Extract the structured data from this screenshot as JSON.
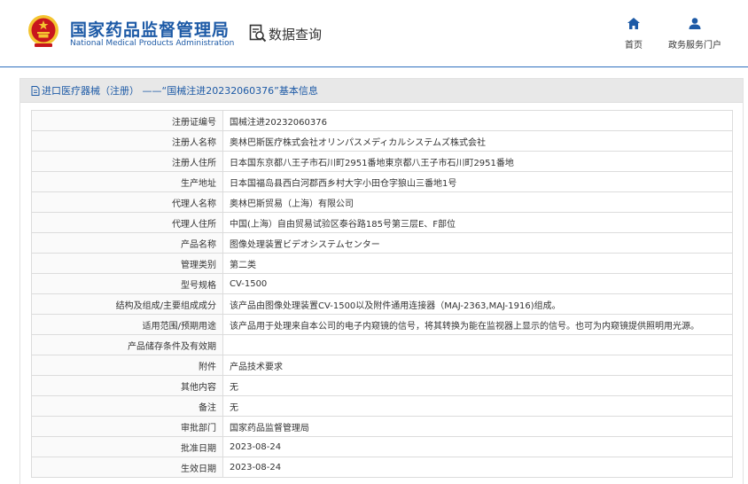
{
  "header": {
    "org_name_cn": "国家药品监督管理局",
    "org_name_en": "National Medical Products Administration",
    "query_title": "数据查询",
    "nav": {
      "home_label": "首页",
      "portal_label": "政务服务门户"
    }
  },
  "panel": {
    "title": "进口医疗器械（注册） ——“国械注进20232060376”基本信息"
  },
  "rows": [
    {
      "label": "注册证编号",
      "value": "国械注进20232060376"
    },
    {
      "label": "注册人名称",
      "value": "奥林巴斯医疗株式会社オリンパスメディカルシステムズ株式会社"
    },
    {
      "label": "注册人住所",
      "value": "日本国东京都八王子市石川町2951番地東京都八王子市石川町2951番地"
    },
    {
      "label": "生产地址",
      "value": "日本国福岛县西白河郡西乡村大字小田仓字狼山三番地1号"
    },
    {
      "label": "代理人名称",
      "value": "奥林巴斯贸易（上海）有限公司"
    },
    {
      "label": "代理人住所",
      "value": "中国(上海）自由贸易试验区泰谷路185号第三层E、F部位"
    },
    {
      "label": "产品名称",
      "value": "图像处理装置ビデオシステムセンター"
    },
    {
      "label": "管理类别",
      "value": "第二类"
    },
    {
      "label": "型号规格",
      "value": "CV-1500"
    },
    {
      "label": "结构及组成/主要组成成分",
      "value": "该产品由图像处理装置CV-1500以及附件通用连接器（MAJ-2363,MAJ-1916)组成。"
    },
    {
      "label": "适用范围/预期用途",
      "value": "该产品用于处理来自本公司的电子内窥镜的信号，将其转换为能在监视器上显示的信号。也可为内窥镜提供照明用光源。"
    },
    {
      "label": "产品储存条件及有效期",
      "value": ""
    },
    {
      "label": "附件",
      "value": "产品技术要求"
    },
    {
      "label": "其他内容",
      "value": "无"
    },
    {
      "label": "备注",
      "value": "无"
    },
    {
      "label": "审批部门",
      "value": "国家药品监督管理局"
    },
    {
      "label": "批准日期",
      "value": "2023-08-24"
    },
    {
      "label": "生效日期",
      "value": "2023-08-24"
    }
  ],
  "colors": {
    "brand_blue": "#1d5aa6",
    "header_line": "#2f6fbf",
    "panel_title_bg": "#e8e8e8",
    "emblem_red": "#c8161d",
    "emblem_gold": "#f4c430"
  },
  "icons": {
    "emblem": "national-emblem-icon",
    "query": "magnifier-document-icon",
    "home": "home-icon",
    "portal": "user-icon",
    "doc": "document-icon"
  }
}
